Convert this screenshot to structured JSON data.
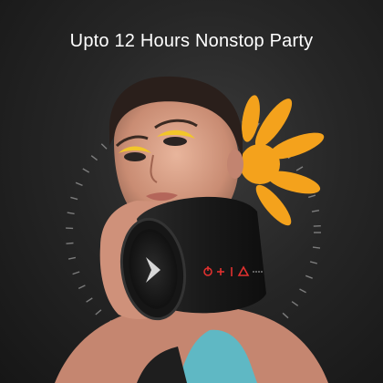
{
  "banner": {
    "headline": "Upto 12 Hours Nonstop Party"
  },
  "product": {
    "kind": "portable bluetooth speaker",
    "body_color": "#1c1c1c",
    "control_icons": [
      "power-icon",
      "plus-icon",
      "volume-icon",
      "mode-triangle-icon"
    ],
    "control_color": "#e2312f"
  },
  "colors": {
    "background": "#232323",
    "accent_flower": "#f4a21c",
    "text": "#ffffff"
  }
}
